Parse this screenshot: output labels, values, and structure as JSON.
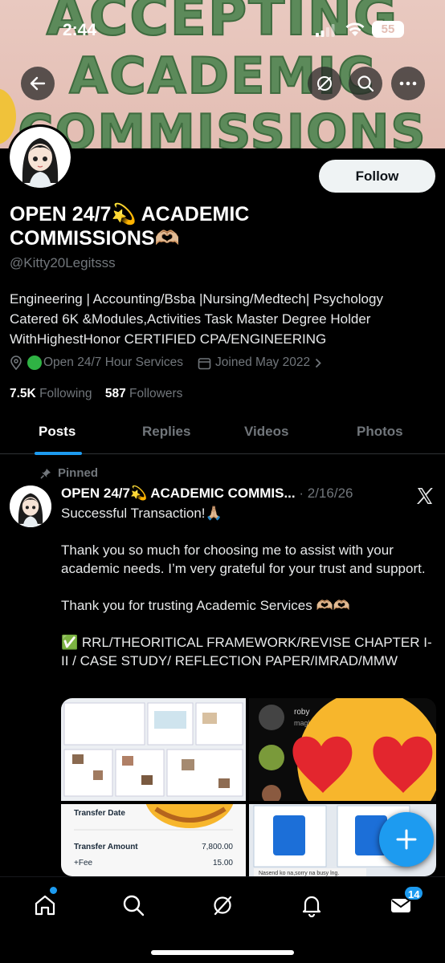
{
  "status_bar": {
    "time": "2:44",
    "battery": "55"
  },
  "banner": {
    "line1": "ACCEPTING",
    "line2": "ACADEMIC",
    "line3": "COMMISSIONS"
  },
  "profile": {
    "follow_label": "Follow",
    "name": "OPEN 24/7💫 ACADEMIC COMMISSIONS🫶🏼",
    "handle": "@Kitty20Legitsss",
    "bio": "Engineering | Accounting/Bsba |Nursing/Medtech| Psychology Catered 6K &Modules,Activities Task Master Degree Holder WithHighestHonor CERTIFIED CPA/ENGINEERING",
    "location": "Open 24/7 Hour Services",
    "joined": "Joined May 2022",
    "following_count": "7.5K",
    "following_label": "Following",
    "followers_count": "587",
    "followers_label": "Followers"
  },
  "tabs": [
    {
      "label": "Posts"
    },
    {
      "label": "Replies"
    },
    {
      "label": "Videos"
    },
    {
      "label": "Photos"
    }
  ],
  "post": {
    "pinned_label": "Pinned",
    "author": "OPEN 24/7💫 ACADEMIC COMMIS...",
    "date": "· 2/16/26",
    "line1": "Successful Transaction!🙏🏼",
    "para2": "Thank you so much for choosing me to assist with your academic needs. I’m very grateful for your trust and support.",
    "para3": "Thank you for trusting Academic Services 🫶🏼🫶🏼",
    "para4": "✅ RRL/THEORITICAL FRAMEWORK/REVISE CHAPTER I-II / CASE STUDY/ REFLECTION PAPER/IMRAD/MMW",
    "media": {
      "transfer_date_label": "Transfer Date",
      "transfer_amount_label": "Transfer Amount",
      "transfer_amount_value": "7,800.00",
      "fee_label": "+Fee",
      "fee_value": "15.00",
      "chat_name": "roby",
      "chat_sub": "magkano",
      "chat_note": "Nasend ko na,sorry na busy lng."
    }
  },
  "bottom_nav": {
    "messages_badge": "14"
  },
  "colors": {
    "accent": "#1d9bf0",
    "banner_text": "#5c8a5a",
    "banner_bg": "#e3bdb3"
  }
}
